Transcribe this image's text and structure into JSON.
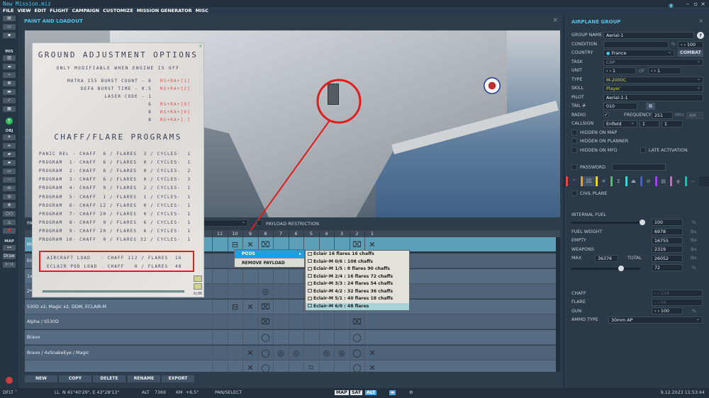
{
  "titlebar": {
    "title": "New Mission.miz"
  },
  "menu": [
    "FILE",
    "VIEW",
    "EDIT",
    "FLIGHT",
    "CAMPAIGN",
    "CUSTOMIZE",
    "MISSION GENERATOR",
    "MISC"
  ],
  "toolbar": {
    "sections": [
      "MIS",
      "OBJ",
      "MAP"
    ],
    "draw_label": "Draw"
  },
  "main": {
    "title": "PAINT AND LOADOUT",
    "close": "×",
    "payload_label": "PA",
    "payload_restriction": "PAYLOAD RESTRICTION",
    "stations": [
      "11",
      "10",
      "9",
      "8",
      "7",
      "6",
      "5",
      "4",
      "3",
      "2",
      "1"
    ],
    "payloads": [
      {
        "name": "Mi",
        "selected": true,
        "icons": {
          "10": "pod",
          "9": "x",
          "8": "sqx",
          "2": "sqx",
          "1": "x"
        }
      },
      {
        "name": "Em",
        "icons": {}
      },
      {
        "name": "1x",
        "icons": {}
      },
      {
        "name": "2*",
        "icons": {
          "8": "target"
        }
      },
      {
        "name": "530D x2, Magic x2, DDM, ECLAIR-M",
        "icons": {
          "10": "pod",
          "9": "x",
          "8": "sqx",
          "2": "sqx",
          "1": "x"
        }
      },
      {
        "name": "Alpha / S530D",
        "icons": {
          "8": "sqx",
          "2": "sqx"
        }
      },
      {
        "name": "Bravo",
        "icons": {
          "8": "circle",
          "2": "circle"
        }
      },
      {
        "name": "Bravo / 4xSnakeEye / Magic",
        "icons": {
          "9": "x",
          "8": "circle",
          "7": "target",
          "6": "target",
          "4": "target",
          "3": "target",
          "2": "circle",
          "1": "x"
        }
      },
      {
        "name": "",
        "icons": {
          "9": "x",
          "8": "circle",
          "5": "sq",
          "2": "circle",
          "1": "x"
        }
      }
    ],
    "buttons": [
      "NEW",
      "COPY",
      "DELETE",
      "RENAME",
      "EXPORT"
    ]
  },
  "context_menu": {
    "items": [
      "PODS",
      "REMOVE PAYLOAD"
    ],
    "pods": [
      "Eclair 16 flares 16 chaffs",
      "Eclair-M 0/6 : 108 chaffs",
      "Eclair-M 1/5 : 8 flares 90 chaffs",
      "Eclair-M 2/4 : 16 flares 72 chaffs",
      "Eclair-M 3/3 : 24 flares 54 chaffs",
      "Eclair-M 4/2 : 32 flares 36 chaffs",
      "Eclair-M 5/1 : 40 flares 18 chaffs",
      "Eclair-M 6/0 : 48 flares"
    ]
  },
  "kneeboard": {
    "title": "GROUND ADJUSTMENT OPTIONS",
    "subtitle": "ONLY MODIFIABLE WHEN ENGINE IS OFF",
    "options": [
      {
        "label": "MATRA 155 BURST COUNT - 6",
        "code": "RS+RA+[1]"
      },
      {
        "label": "DEFA BURST TIME - 0.5",
        "code": "RS+RA+[2]"
      },
      {
        "label": "LASER CODE - 1",
        "code": ""
      },
      {
        "label": "6",
        "code": "RS+RA+[9]"
      },
      {
        "label": "8",
        "code": "RS+RA+[0]"
      },
      {
        "label": "8",
        "code": "RS+RA+[-]"
      }
    ],
    "programs_title": "CHAFF/FLARE PROGRAMS",
    "programs": [
      "PANIC REL · CHAFF  6 / FLARES  3 / CYCLES·  1",
      "PROGRAM  1· CHAFF  6 / FLARES  0 / CYCLES·  1",
      "PROGRAM  2· CHAFF  6 / FLARES  0 / CYCLES·  2",
      "PROGRAM  3· CHAFF  6 / FLARES  0 / CYCLES·  3",
      "PROGRAM  4· CHAFF  0 / FLARES  2 / CYCLES·  1",
      "PROGRAM  5· CHAFF  1 / FLARES  1 / CYCLES·  1",
      "PROGRAM  6· CHAFF 12 / FLARES  0 / CYCLES·  1",
      "PROGRAM  7· CHAFF 20 / FLARES  0 / CYCLES·  1",
      "PROGRAM  8· CHAFF  0 / FLARES  6 / CYCLES·  1",
      "PROGRAM  9· CHAFF 20 / FLARES  6 / CYCLES·  1",
      "PROGRAM 10· CHAFF  0 / FLARES 32 / CYCLES·  1"
    ],
    "loads": [
      "AIRCRAFT LOAD   · CHAFF 112 / FLARES  16",
      "ECLAIR POD LOAD · CHAFF   0 / FLARES  48"
    ],
    "page": "8|86"
  },
  "group": {
    "title": "AIRPLANE GROUP",
    "close": "×",
    "group_name_label": "GROUP NAME",
    "group_name": "Aerial-1",
    "help": "?",
    "condition_label": "CONDITION",
    "condition_unit": "%",
    "condition_value": "‹ › 100",
    "country_label": "COUNTRY",
    "country": "France",
    "combat": "COMBAT",
    "task_label": "TASK",
    "task": "CAP",
    "unit_label": "UNIT",
    "unit": "‹ › 1",
    "of": "OF",
    "unit_of": "‹ › 1",
    "type_label": "TYPE",
    "type": "M-2000C",
    "skill_label": "SKILL",
    "skill": "Player",
    "pilot_label": "PILOT",
    "pilot": "Aerial-1-1",
    "tail_label": "TAIL #",
    "tail": "010",
    "radio_label": "RADIO",
    "frequency_label": "FREQUENCY",
    "frequency": "251",
    "mhz": "MHz",
    "modulation": "AM",
    "callsign_label": "CALLSIGN",
    "callsign": "Enfield",
    "callsign_1": "1",
    "callsign_2": "1",
    "hidden_map": "HIDDEN ON MAP",
    "hidden_planner": "HIDDEN ON PLANNER",
    "hidden_mfd": "HIDDEN ON MFD",
    "late_activation": "LATE ACTIVATION",
    "password_label": "PASSWORD",
    "civil_plane": "CIVIL PLANE",
    "internal_fuel_label": "INTERNAL FUEL",
    "internal_fuel": "100",
    "internal_fuel_fraction": 1.0,
    "pct": "%",
    "fuel_weight_label": "FUEL WEIGHT",
    "fuel_weight": "6978",
    "lbs": "lbs",
    "empty_label": "EMPTY",
    "empty": "16755",
    "weapons_label": "WEAPONS",
    "weapons": "2319",
    "max_label": "MAX",
    "max": "36376",
    "total_label": "TOTAL",
    "total": "26052",
    "load_pct": "72",
    "load_fraction": 0.72,
    "chaff_label": "CHAFF",
    "chaff": "‹ › 234",
    "flare_label": "FLARE",
    "flare": "‹ › 64",
    "gun_label": "GUN",
    "gun": "‹ › 100",
    "ammo_label": "AMMO TYPE",
    "ammo": "30mm AP",
    "tab_colors": [
      "#e84545",
      "#f39a2b",
      "#e6d630",
      "#44c95a",
      "#3fd0d0",
      "#3a5cf0",
      "#9a45e8",
      "#e05ad8",
      "#2fb3a8"
    ]
  },
  "status": {
    "layer": "DFLT ˅",
    "ll": "LL",
    "coords": "N 41°40'29\", E 43°28'13\"",
    "alt_label": "ALT",
    "alt": "7369",
    "wind": "6M",
    "magvar": "+6.5°",
    "mode": "PAN/SELECT",
    "map": "MAP",
    "sat": "SAT",
    "alt_btn": "ALT",
    "datetime": "9.12.2023 11:53:44"
  }
}
